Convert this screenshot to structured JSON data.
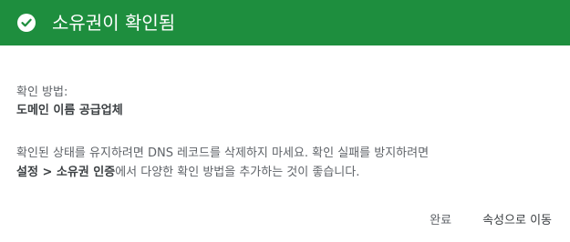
{
  "header": {
    "title": "소유권이 확인됨",
    "bg_color": "#1e8e3e",
    "icon": "check-circle-icon"
  },
  "method": {
    "label": "확인 방법:",
    "value": "도메인 이름 공급업체"
  },
  "description": {
    "line1": "확인된 상태를 유지하려면 DNS 레코드를 삭제하지 마세요. 확인 실패를 방지하려면",
    "link_bold": "설정 > 소유권 인증",
    "line2_rest": "에서 다양한 확인 방법을 추가하는 것이 좋습니다."
  },
  "actions": {
    "done_label": "완료",
    "go_to_property_label": "속성으로 이동"
  }
}
